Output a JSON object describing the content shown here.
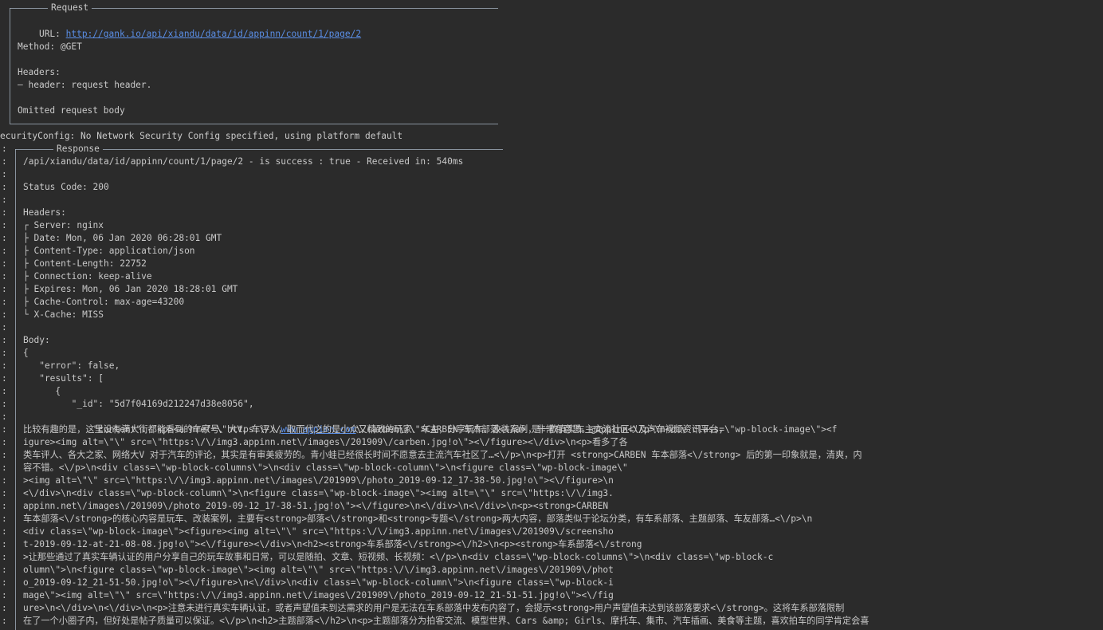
{
  "request_box": {
    "title": "Request",
    "url_label": "URL: ",
    "url": "http://gank.io/api/xiandu/data/id/appinn/count/1/page/2",
    "method": "Method: @GET",
    "headers_label": "Headers:",
    "header_line": "— header: request header.",
    "body_note": "Omitted request body"
  },
  "security_line": "ecurityConfig: No Network Security Config specified, using platform default",
  "response_box": {
    "title": "Response",
    "summary": "/api/xiandu/data/id/appinn/count/1/page/2 - is success : true - Received in: 540ms",
    "status": "Status Code: 200",
    "headers_label": "Headers:",
    "headers": [
      "┌ Server: nginx",
      "├ Date: Mon, 06 Jan 2020 06:28:01 GMT",
      "├ Content-Type: application/json",
      "├ Content-Length: 22752",
      "├ Connection: keep-alive",
      "├ Expires: Mon, 06 Jan 2020 18:28:01 GMT",
      "├ Cache-Control: max-age=43200",
      "└ X-Cache: MISS"
    ],
    "body_label": "Body:",
    "json_lines": [
      "{",
      "   \"error\": false,",
      "   \"results\": [",
      "      {",
      "         \"_id\": \"5d7f04169d212247d38e8056\","
    ],
    "content_prefix": "         \"content\": \"<p><a href=\\\"https:\\/\\/",
    "content_link": "www.appinn.com",
    "content_suffix": "\\/carben\\/\\\">CARBEN 车本部落<\\/a> 是一款真实车主交流社区以及汽车视频资讯平台,",
    "wrapped_lines": [
      "比较有趣的是，这里没有满大街都能看到的车家号、大V、车评人，取而代之的是小众又精致的玩家、车主，分享玩车、改装案例，非常有意思。@Appinn<\\/p>\\n<div class=\\\"wp-block-image\\\"><f",
      "igure><img alt=\\\"\\\" src=\\\"https:\\/\\/img3.appinn.net\\/images\\/201909\\/carben.jpg!o\\\"><\\/figure><\\/div>\\n<p>看多了各",
      "类车评人、各大之家、网络大V 对于汽车的评论，其实是有审美疲劳的。青小蛙已经很长时间不愿意去主流汽车社区了…<\\/p>\\n<p>打开 <strong>CARBEN 车本部落<\\/strong> 后的第一印象就是，清爽，内",
      "容不错。<\\/p>\\n<div class=\\\"wp-block-columns\\\">\\n<div class=\\\"wp-block-column\\\">\\n<figure class=\\\"wp-block-image\\\"",
      "><img alt=\\\"\\\" src=\\\"https:\\/\\/img3.appinn.net\\/images\\/201909\\/photo_2019-09-12_17-38-50.jpg!o\\\"><\\/figure>\\n",
      "<\\/div>\\n<div class=\\\"wp-block-column\\\">\\n<figure class=\\\"wp-block-image\\\"><img alt=\\\"\\\" src=\\\"https:\\/\\/img3.",
      "appinn.net\\/images\\/201909\\/photo_2019-09-12_17-38-51.jpg!o\\\"><\\/figure>\\n<\\/div>\\n<\\/div>\\n<p><strong>CARBEN",
      "车本部落<\\/strong>的核心内容是玩车、改装案例，主要有<strong>部落<\\/strong>和<strong>专题<\\/strong>两大内容，部落类似于论坛分类，有车系部落、主题部落、车友部落…<\\/p>\\n",
      "<div class=\\\"wp-block-image\\\"><figure><img alt=\\\"\\\" src=\\\"https:\\/\\/img3.appinn.net\\/images\\/201909\\/screensho",
      "t-2019-09-12-at-21-08-08.jpg!o\\\"><\\/figure><\\/div>\\n<h2><strong>车系部落<\\/strong><\\/h2>\\n<p><strong>车系部落<\\/strong",
      ">让那些通过了真实车辆认证的用户分享自己的玩车故事和日常，可以是随拍、文章、短视频、长视频：<\\/p>\\n<div class=\\\"wp-block-columns\\\">\\n<div class=\\\"wp-block-c",
      "olumn\\\">\\n<figure class=\\\"wp-block-image\\\"><img alt=\\\"\\\" src=\\\"https:\\/\\/img3.appinn.net\\/images\\/201909\\/phot",
      "o_2019-09-12_21-51-50.jpg!o\\\"><\\/figure>\\n<\\/div>\\n<div class=\\\"wp-block-column\\\">\\n<figure class=\\\"wp-block-i",
      "mage\\\"><img alt=\\\"\\\" src=\\\"https:\\/\\/img3.appinn.net\\/images\\/201909\\/photo_2019-09-12_21-51-51.jpg!o\\\"><\\/fig",
      "ure>\\n<\\/div>\\n<\\/div>\\n<p>注意未进行真实车辆认证，或者声望值未到达需求的用户是无法在车系部落中发布内容了，会提示<strong>用户声望值未达到该部落要求<\\/strong>。这将车系部落限制",
      "在了一个小圈子内，但好处是帖子质量可以保证。<\\/p>\\n<h2>主题部落<\\/h2>\\n<p>主题部落分为拍客交流、模型世界、Cars &amp; Girls、摩托车、集市、汽车插画、美食等主题，喜欢拍车的同学肯定会喜"
    ]
  }
}
